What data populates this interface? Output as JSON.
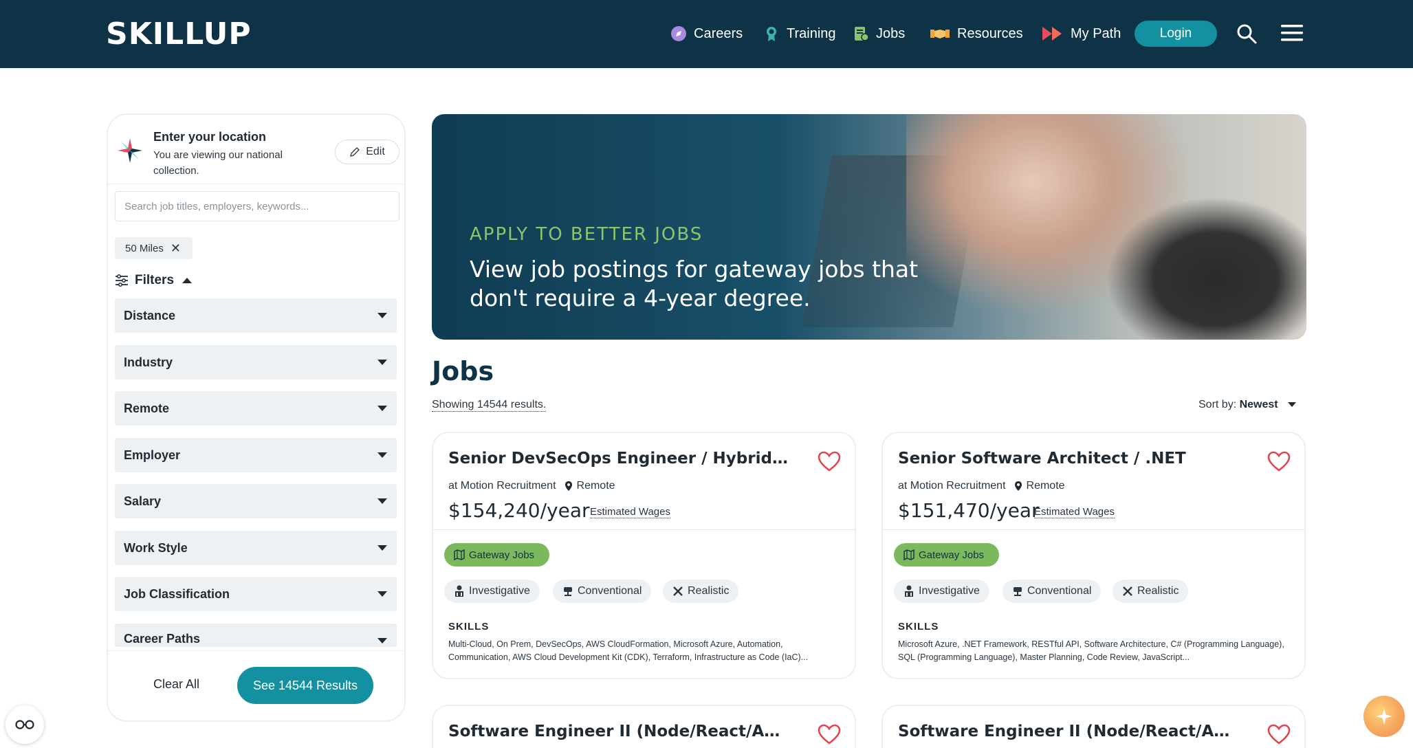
{
  "header": {
    "logo": "SKILLUP",
    "nav": [
      {
        "label": "Careers",
        "icon": "compass-icon"
      },
      {
        "label": "Training",
        "icon": "award-icon"
      },
      {
        "label": "Jobs",
        "icon": "jobs-icon"
      },
      {
        "label": "Resources",
        "icon": "handshake-icon"
      },
      {
        "label": "My Path",
        "icon": "path-arrows-icon"
      }
    ],
    "login_label": "Login"
  },
  "sidebar": {
    "location_title": "Enter your location",
    "location_sub": "You are viewing our national collection.",
    "edit_label": "Edit",
    "search_placeholder": "Search job titles, employers, keywords...",
    "distance_chip": "50 Miles",
    "filters_label": "Filters",
    "filters": [
      "Distance",
      "Industry",
      "Remote",
      "Employer",
      "Salary",
      "Work Style",
      "Job Classification",
      "Career Paths"
    ],
    "clear_all": "Clear All",
    "see_results": "See 14544 Results"
  },
  "hero": {
    "kicker": "APPLY TO BETTER JOBS",
    "text": "View job postings for gateway jobs that don't require a 4-year degree."
  },
  "main": {
    "title": "Jobs",
    "showing": "Showing 14544 results.",
    "sort_label": "Sort by:",
    "sort_value": "Newest"
  },
  "jobs": [
    {
      "title": "Senior DevSecOps Engineer / Hybrid in...",
      "employer": "at Motion Recruitment",
      "location": "Remote",
      "wage": "$154,240/year",
      "wage_note": "Estimated Wages",
      "badge": "Gateway Jobs",
      "tags": [
        "Investigative",
        "Conventional",
        "Realistic"
      ],
      "skills_label": "SKILLS",
      "skills": "Multi-Cloud, On Prem, DevSecOps, AWS CloudFormation, Microsoft Azure, Automation, Communication, AWS Cloud Development Kit (CDK), Terraform, Infrastructure as Code (IaC)..."
    },
    {
      "title": "Senior Software Architect / .NET",
      "employer": "at Motion Recruitment",
      "location": "Remote",
      "wage": "$151,470/year",
      "wage_note": "Estimated Wages",
      "badge": "Gateway Jobs",
      "tags": [
        "Investigative",
        "Conventional",
        "Realistic"
      ],
      "skills_label": "SKILLS",
      "skills": "Microsoft Azure, .NET Framework, RESTful API, Software Architecture, C# (Programming Language), SQL (Programming Language), Master Planning, Code Review, JavaScript..."
    },
    {
      "title": "Software Engineer II (Node/React/Aws)"
    },
    {
      "title": "Software Engineer II (Node/React/Aws)"
    }
  ],
  "colors": {
    "header_bg": "#0e3347",
    "accent": "#1491a0",
    "gateway_green": "#7cb85c",
    "heart_red": "#e0464f"
  }
}
